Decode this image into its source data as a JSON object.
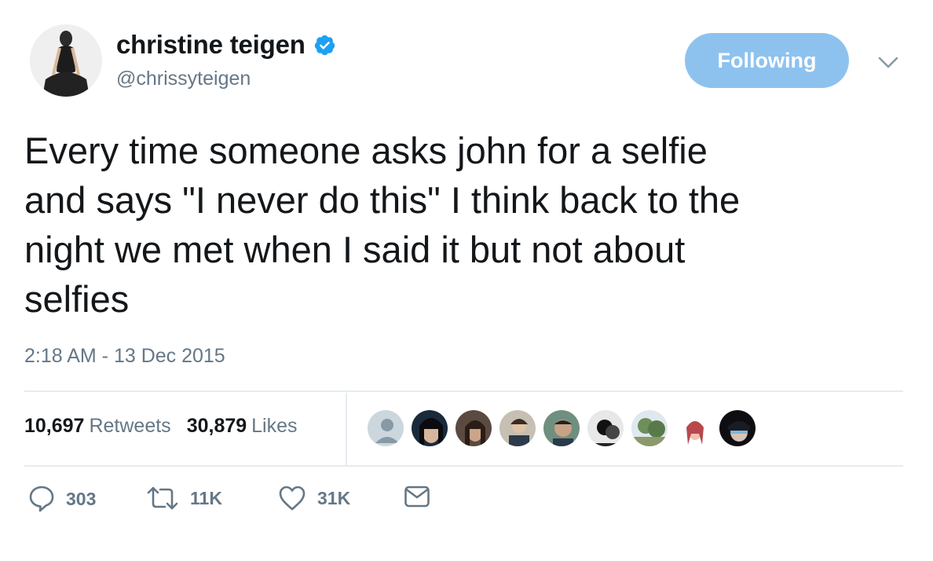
{
  "author": {
    "name": "christine teigen",
    "handle": "@chrissyteigen",
    "verified": true
  },
  "follow_button": {
    "label": "Following"
  },
  "tweet": {
    "text": "Every time someone asks john for a selfie\nand says \"I never do this\" I think back to the\nnight we met when I said it but not about\nselfies",
    "timestamp": "2:18 AM - 13 Dec 2015"
  },
  "stats": {
    "retweets_count": "10,697",
    "retweets_label": "Retweets",
    "likes_count": "30,879",
    "likes_label": "Likes"
  },
  "actions": {
    "reply_count": "303",
    "retweet_count": "11K",
    "like_count": "31K"
  },
  "colors": {
    "follow_bg": "#8ec2ee",
    "verified_blue": "#1da1f2",
    "secondary_text": "#657786",
    "divider": "#e6ecf0"
  }
}
